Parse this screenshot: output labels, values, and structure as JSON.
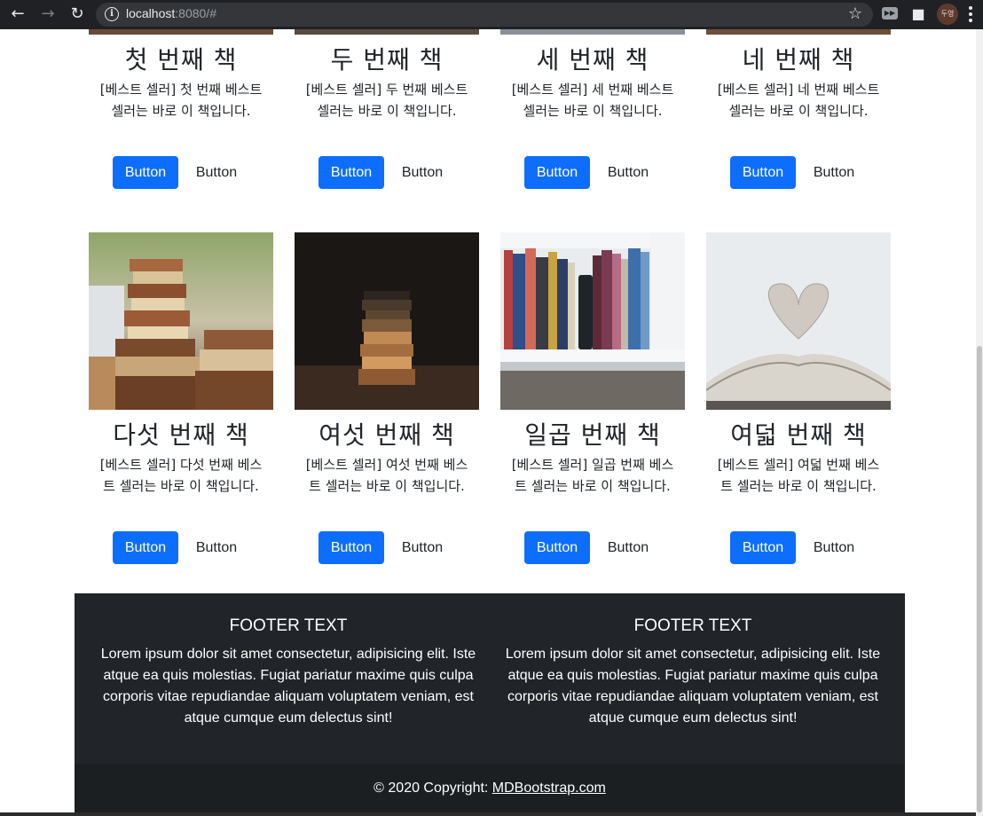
{
  "browser": {
    "url_host": "localhost",
    "url_rest": ":8080/#",
    "profile_label": "두영"
  },
  "cards": [
    {
      "title": "첫 번째 책",
      "text": "[베스트 셀러] 첫 번째 베스트 셀러는 바로 이 책입니다.",
      "primary_label": "Button",
      "secondary_label": "Button"
    },
    {
      "title": "두 번째 책",
      "text": "[베스트 셀러] 두 번째 베스트 셀러는 바로 이 책입니다.",
      "primary_label": "Button",
      "secondary_label": "Button"
    },
    {
      "title": "세 번째 책",
      "text": "[베스트 셀러] 세 번째 베스트 셀러는 바로 이 책입니다.",
      "primary_label": "Button",
      "secondary_label": "Button"
    },
    {
      "title": "네 번째 책",
      "text": "[베스트 셀러] 네 번째 베스트 셀러는 바로 이 책입니다.",
      "primary_label": "Button",
      "secondary_label": "Button"
    },
    {
      "title": "다섯 번째 책",
      "text": "[베스트 셀러] 다섯 번째 베스트 셀러는 바로 이 책입니다.",
      "primary_label": "Button",
      "secondary_label": "Button"
    },
    {
      "title": "여섯 번째 책",
      "text": "[베스트 셀러] 여섯 번째 베스트 셀러는 바로 이 책입니다.",
      "primary_label": "Button",
      "secondary_label": "Button"
    },
    {
      "title": "일곱 번째 책",
      "text": "[베스트 셀러] 일곱 번째 베스트 셀러는 바로 이 책입니다.",
      "primary_label": "Button",
      "secondary_label": "Button"
    },
    {
      "title": "여덟 번째 책",
      "text": "[베스트 셀러] 여덟 번째 베스트 셀러는 바로 이 책입니다.",
      "primary_label": "Button",
      "secondary_label": "Button"
    }
  ],
  "footer": {
    "columns": [
      {
        "title": "FOOTER TEXT",
        "body": "Lorem ipsum dolor sit amet consectetur, adipisicing elit. Iste atque ea quis molestias. Fugiat pariatur maxime quis culpa corporis vitae repudiandae aliquam voluptatem veniam, est atque cumque eum delectus sint!"
      },
      {
        "title": "FOOTER TEXT",
        "body": "Lorem ipsum dolor sit amet consectetur, adipisicing elit. Iste atque ea quis molestias. Fugiat pariatur maxime quis culpa corporis vitae repudiandae aliquam voluptatem veniam, est atque cumque eum delectus sint!"
      }
    ],
    "copyright_prefix": "© 2020 Copyright: ",
    "copyright_link": "MDBootstrap.com"
  },
  "colors": {
    "primary": "#0d6efd",
    "footer_bg": "#212529",
    "copyright_bg": "#1c1f22"
  }
}
